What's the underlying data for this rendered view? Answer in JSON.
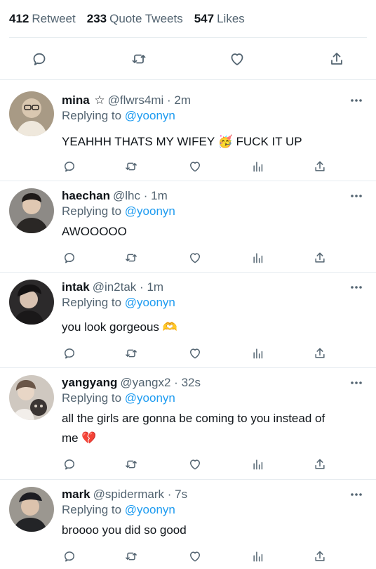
{
  "stats": {
    "retweets": {
      "count": "412",
      "label": "Retweet"
    },
    "quotes": {
      "count": "233",
      "label": "Quote Tweets"
    },
    "likes": {
      "count": "547",
      "label": "Likes"
    }
  },
  "colors": {
    "text": "#0f1419",
    "secondary": "#536471",
    "accent": "#1d9bf0",
    "divider": "#e6ecf0"
  },
  "main_actions": [
    "reply-icon",
    "retweet-icon",
    "like-icon",
    "share-icon"
  ],
  "reply_actions": [
    "reply-icon",
    "retweet-icon",
    "like-icon",
    "analytics-icon",
    "share-icon"
  ],
  "replying_label": "Replying to",
  "replying_target": "@yoonyn",
  "replies": [
    {
      "name": "mina",
      "star": "☆",
      "handle": "@flwrs4mi",
      "dot": "·",
      "time": "2m",
      "text_line1": "YEAHHH THATS MY WIFEY 🥳  FUCK IT UP",
      "text_line2": ""
    },
    {
      "name": "haechan",
      "star": "",
      "handle": "@lhc",
      "dot": "·",
      "time": "1m",
      "text_line1": "AWOOOOO",
      "text_line2": ""
    },
    {
      "name": "intak",
      "star": "",
      "handle": "@in2tak",
      "dot": "·",
      "time": "1m",
      "text_line1": "you look gorgeous 🫶",
      "text_line2": ""
    },
    {
      "name": "yangyang",
      "star": "",
      "handle": "@yangx2",
      "dot": "·",
      "time": "32s",
      "text_line1": "all the girls are gonna be coming to you instead of",
      "text_line2": "me 💔"
    },
    {
      "name": "mark",
      "star": "",
      "handle": "@spidermark",
      "dot": "·",
      "time": "7s",
      "text_line1": "broooo you did so good",
      "text_line2": ""
    }
  ]
}
